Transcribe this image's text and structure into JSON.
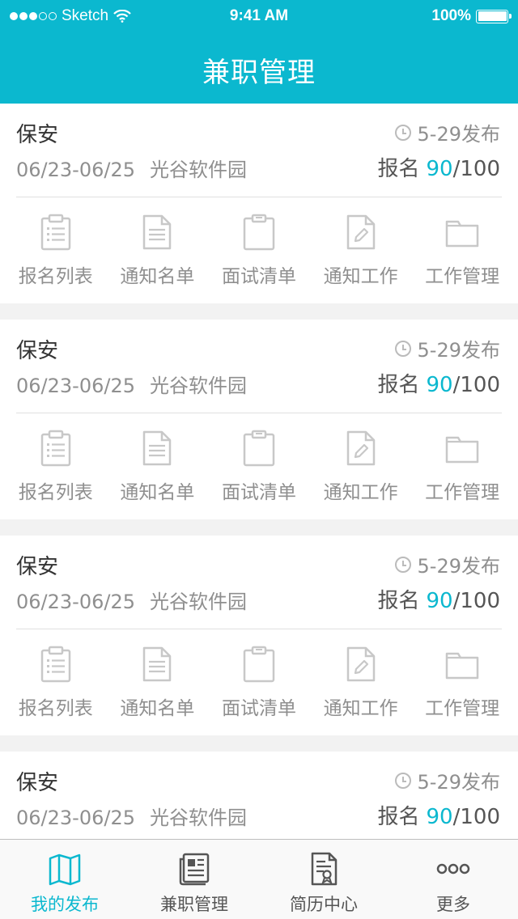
{
  "status_bar": {
    "carrier": "Sketch",
    "time": "9:41 AM",
    "battery": "100%"
  },
  "nav": {
    "title": "兼职管理"
  },
  "cards": [
    {
      "title": "保安",
      "published": "5-29发布",
      "date_range": "06/23-06/25",
      "location": "光谷软件园",
      "signup_label": "报名",
      "signup_count": "90",
      "signup_total": "/100"
    },
    {
      "title": "保安",
      "published": "5-29发布",
      "date_range": "06/23-06/25",
      "location": "光谷软件园",
      "signup_label": "报名",
      "signup_count": "90",
      "signup_total": "/100"
    },
    {
      "title": "保安",
      "published": "5-29发布",
      "date_range": "06/23-06/25",
      "location": "光谷软件园",
      "signup_label": "报名",
      "signup_count": "90",
      "signup_total": "/100"
    },
    {
      "title": "保安",
      "published": "5-29发布",
      "date_range": "06/23-06/25",
      "location": "光谷软件园",
      "signup_label": "报名",
      "signup_count": "90",
      "signup_total": "/100"
    }
  ],
  "actions": [
    {
      "label": "报名列表",
      "icon": "clipboard-list-icon"
    },
    {
      "label": "通知名单",
      "icon": "document-icon"
    },
    {
      "label": "面试清单",
      "icon": "clipboard-icon"
    },
    {
      "label": "通知工作",
      "icon": "edit-document-icon"
    },
    {
      "label": "工作管理",
      "icon": "folder-icon"
    }
  ],
  "tabbar": {
    "items": [
      {
        "label": "我的发布",
        "icon": "map-icon",
        "active": true
      },
      {
        "label": "兼职管理",
        "icon": "newspaper-icon",
        "active": false
      },
      {
        "label": "简历中心",
        "icon": "resume-icon",
        "active": false
      },
      {
        "label": "更多",
        "icon": "more-icon",
        "active": false
      }
    ]
  },
  "colors": {
    "accent": "#0bb8cf",
    "text": "#333333",
    "muted": "#8f8f8f",
    "icon": "#c8c8c8",
    "background": "#f2f2f2"
  }
}
